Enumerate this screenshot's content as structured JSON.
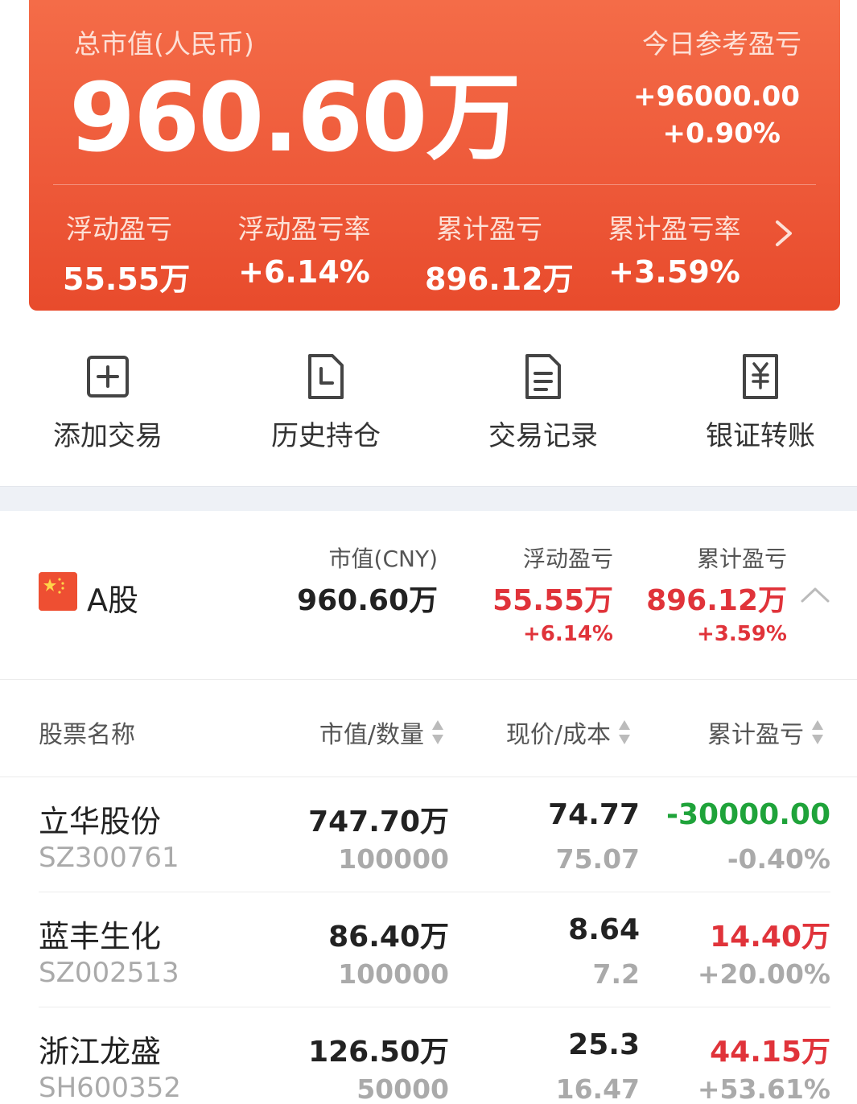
{
  "hero": {
    "total_label": "总市值(人民币)",
    "total_value": "960.60万",
    "today_label": "今日参考盈亏",
    "today_amount": "+96000.00",
    "today_percent": "+0.90%",
    "metrics": [
      {
        "label": "浮动盈亏",
        "value": "55.55万"
      },
      {
        "label": "浮动盈亏率",
        "value": "+6.14%"
      },
      {
        "label": "累计盈亏",
        "value": "896.12万"
      },
      {
        "label": "累计盈亏率",
        "value": "+3.59%"
      }
    ],
    "more_icon": "chevron-right-icon"
  },
  "actions": [
    {
      "label": "添加交易",
      "icon": "add-square-icon"
    },
    {
      "label": "历史持仓",
      "icon": "history-doc-icon"
    },
    {
      "label": "交易记录",
      "icon": "document-list-icon"
    },
    {
      "label": "银证转账",
      "icon": "yuan-transfer-icon"
    }
  ],
  "summary": {
    "market": "A股",
    "flag_icon": "china-flag-icon",
    "market_value_label": "市值(CNY)",
    "market_value": "960.60万",
    "float_label": "浮动盈亏",
    "float_value": "55.55万",
    "float_pct": "+6.14%",
    "cum_label": "累计盈亏",
    "cum_value": "896.12万",
    "cum_pct": "+3.59%",
    "collapse_icon": "chevron-up-icon"
  },
  "table": {
    "headers": [
      "股票名称",
      "市值/数量",
      "现价/成本",
      "累计盈亏"
    ],
    "rows": [
      {
        "name": "立华股份",
        "code": "SZ300761",
        "market_value": "747.70万",
        "quantity": "100000",
        "price": "74.77",
        "cost": "75.07",
        "pnl": "-30000.00",
        "pnl_pct": "-0.40%",
        "trend": "down"
      },
      {
        "name": "蓝丰生化",
        "code": "SZ002513",
        "market_value": "86.40万",
        "quantity": "100000",
        "price": "8.64",
        "cost": "7.2",
        "pnl": "14.40万",
        "pnl_pct": "+20.00%",
        "trend": "up"
      },
      {
        "name": "浙江龙盛",
        "code": "SH600352",
        "market_value": "126.50万",
        "quantity": "50000",
        "price": "25.3",
        "cost": "16.47",
        "pnl": "44.15万",
        "pnl_pct": "+53.61%",
        "trend": "up"
      }
    ]
  },
  "colors": {
    "brand": "#ee5a3a",
    "up": "#e0333a",
    "down": "#1fa33a"
  }
}
